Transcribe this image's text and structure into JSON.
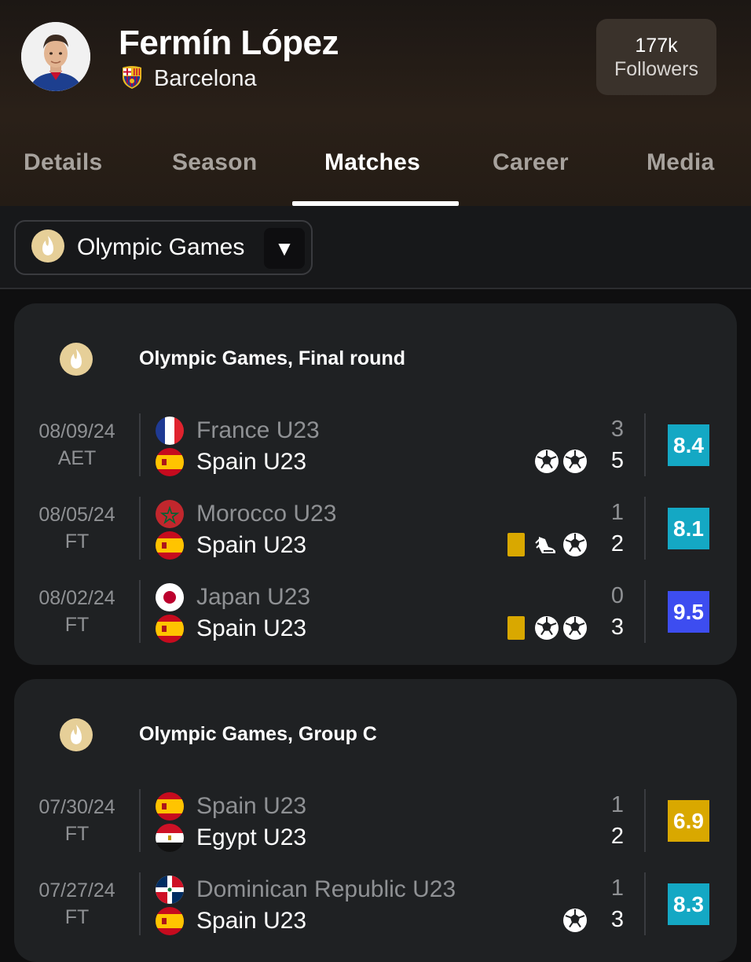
{
  "player": {
    "name": "Fermín López",
    "club": "Barcelona"
  },
  "followers": {
    "count": "177k",
    "label": "Followers"
  },
  "tabs": [
    {
      "label": "Details",
      "active": false
    },
    {
      "label": "Season",
      "active": false
    },
    {
      "label": "Matches",
      "active": true
    },
    {
      "label": "Career",
      "active": false
    },
    {
      "label": "Media",
      "active": false
    }
  ],
  "filter": {
    "selected": "Olympic Games"
  },
  "cards": [
    {
      "title": "Olympic Games, Final round",
      "matches": [
        {
          "date": "08/09/24",
          "status": "AET",
          "home": "France U23",
          "away": "Spain U23",
          "home_score": "3",
          "away_score": "5",
          "events": [
            "ball",
            "ball"
          ],
          "rating": "8.4",
          "rating_color": "#14a8c4"
        },
        {
          "date": "08/05/24",
          "status": "FT",
          "home": "Morocco U23",
          "away": "Spain U23",
          "home_score": "1",
          "away_score": "2",
          "events": [
            "yellow-card",
            "assist-boot",
            "ball"
          ],
          "rating": "8.1",
          "rating_color": "#14a8c4"
        },
        {
          "date": "08/02/24",
          "status": "FT",
          "home": "Japan U23",
          "away": "Spain U23",
          "home_score": "0",
          "away_score": "3",
          "events": [
            "yellow-card",
            "ball",
            "ball"
          ],
          "rating": "9.5",
          "rating_color": "#3d4df0"
        }
      ]
    },
    {
      "title": "Olympic Games, Group C",
      "matches": [
        {
          "date": "07/30/24",
          "status": "FT",
          "home": "Spain U23",
          "away": "Egypt U23",
          "home_score": "1",
          "away_score": "2",
          "events": [],
          "rating": "6.9",
          "rating_color": "#d9a800"
        },
        {
          "date": "07/27/24",
          "status": "FT",
          "home": "Dominican Republic U23",
          "away": "Spain U23",
          "home_score": "1",
          "away_score": "3",
          "events": [
            "ball"
          ],
          "rating": "8.3",
          "rating_color": "#14a8c4"
        }
      ]
    }
  ]
}
